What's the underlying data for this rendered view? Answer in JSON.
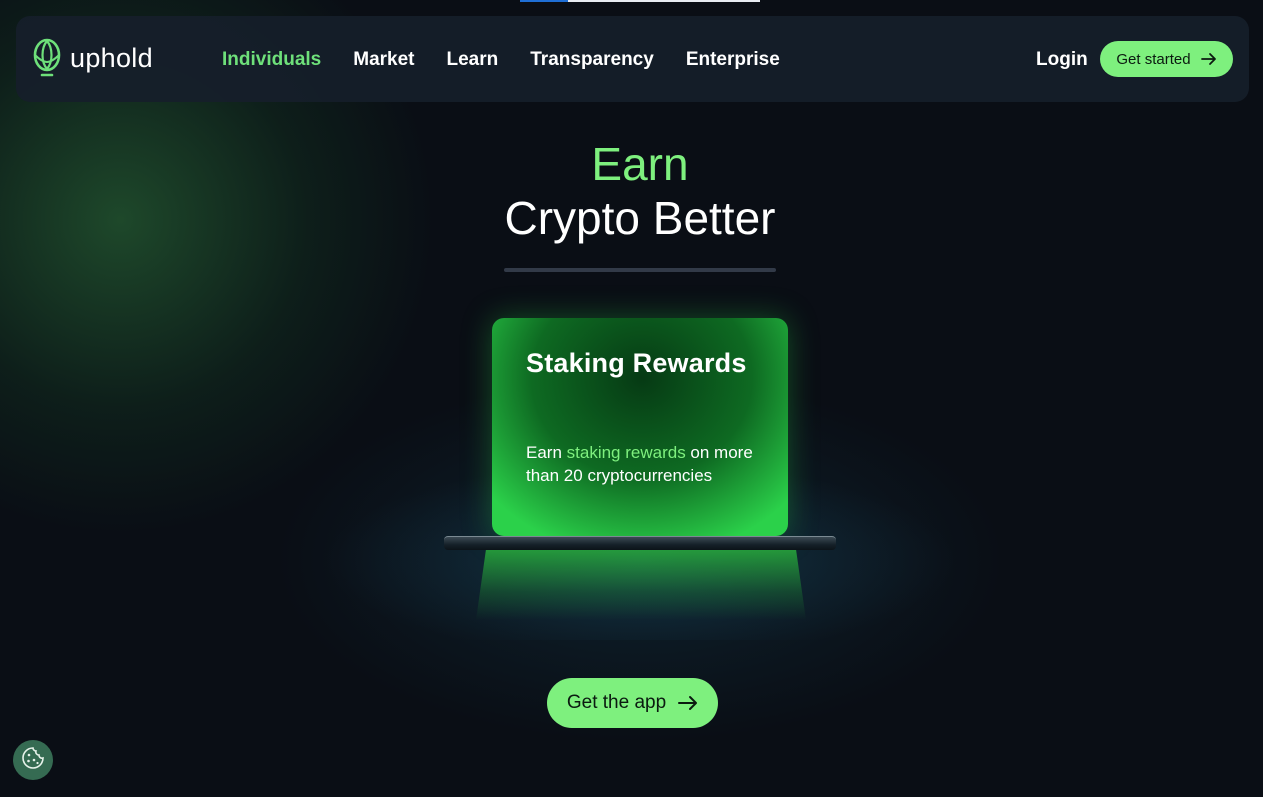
{
  "brand": {
    "name": "uphold",
    "logo_icon": "uphold-leaf-icon",
    "accent": "#7ef07e"
  },
  "nav": {
    "items": [
      {
        "label": "Individuals",
        "active": true
      },
      {
        "label": "Market",
        "active": false
      },
      {
        "label": "Learn",
        "active": false
      },
      {
        "label": "Transparency",
        "active": false
      },
      {
        "label": "Enterprise",
        "active": false
      }
    ],
    "login_label": "Login",
    "cta_label": "Get started",
    "cta_icon": "arrow-right-icon"
  },
  "hero": {
    "line1": "Earn",
    "line2": "Crypto Better"
  },
  "card": {
    "title": "Staking Rewards",
    "body_before": "Earn ",
    "body_highlight": "staking rewards",
    "body_after": " on more than 20 cryptocurrencies"
  },
  "cta": {
    "label": "Get the app",
    "icon": "arrow-right-icon"
  },
  "cookie": {
    "icon": "cookie-icon"
  }
}
